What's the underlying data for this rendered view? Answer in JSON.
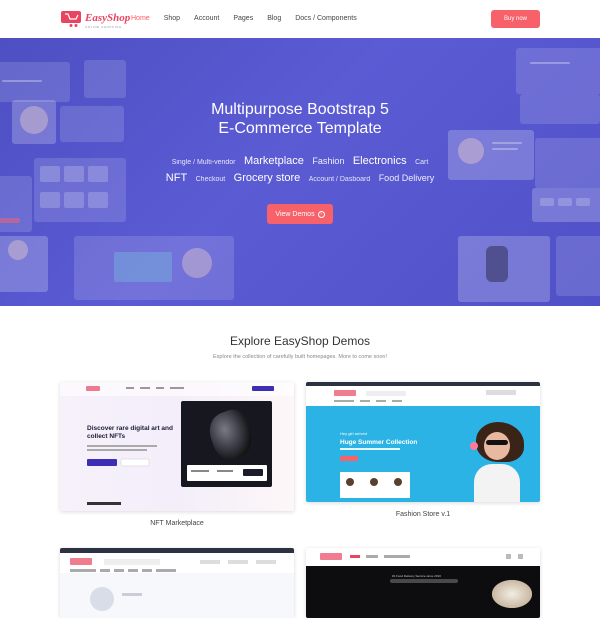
{
  "brand": {
    "name": "EasyShop",
    "tagline": "ONLINE SHOPPING",
    "accent": "#f7626a"
  },
  "nav": {
    "items": [
      {
        "label": "Home",
        "active": true
      },
      {
        "label": "Shop",
        "active": false
      },
      {
        "label": "Account",
        "active": false
      },
      {
        "label": "Pages",
        "active": false
      },
      {
        "label": "Blog",
        "active": false
      },
      {
        "label": "Docs / Components",
        "active": false
      }
    ],
    "buy_label": "Buy now"
  },
  "hero": {
    "background": "#5253c9",
    "title_line1": "Multipurpose Bootstrap 5",
    "title_line2": "E-Commerce Template",
    "tags_row1": [
      {
        "text": "Single / Multi-vendor",
        "size": "s"
      },
      {
        "text": "Marketplace",
        "size": "l"
      },
      {
        "text": "Fashion",
        "size": "m"
      },
      {
        "text": "Electronics",
        "size": "l"
      },
      {
        "text": "Cart",
        "size": "s"
      }
    ],
    "tags_row2": [
      {
        "text": "NFT",
        "size": "l"
      },
      {
        "text": "Checkout",
        "size": "s"
      },
      {
        "text": "Grocery store",
        "size": "l"
      },
      {
        "text": "Account / Dasboard",
        "size": "s"
      },
      {
        "text": "Food Delivery",
        "size": "m"
      }
    ],
    "cta_label": "View Demos",
    "cta_icon": "arrow-right-circle-icon"
  },
  "explore": {
    "title": "Explore EasyShop Demos",
    "subtitle": "Explore the collection of carefully built homepages. More to come soon!"
  },
  "demos": [
    {
      "label": "NFT Marketplace",
      "headline": "Discover rare digital art and collect NFTs"
    },
    {
      "label": "Fashion Store v.1",
      "banner_pre": "Hey girl arrived",
      "banner_title": "Huge Summer Collection"
    },
    {
      "label": ""
    },
    {
      "label": "",
      "banner_pre": "#1 Food Delivery Service since 2010"
    }
  ]
}
